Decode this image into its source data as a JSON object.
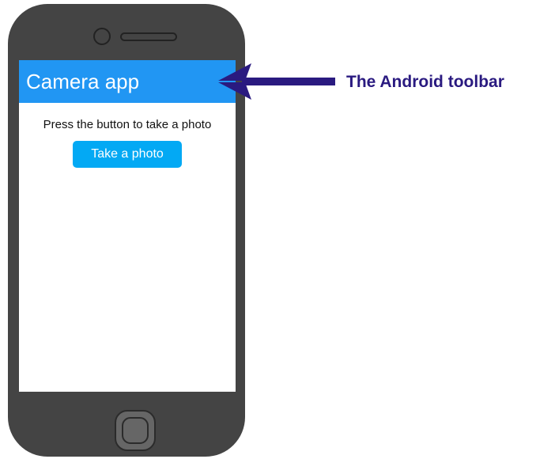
{
  "phone": {
    "toolbar": {
      "title": "Camera app"
    },
    "content": {
      "prompt": "Press the button to take a photo",
      "button_label": "Take a photo"
    }
  },
  "annotation": {
    "label": "The Android toolbar"
  },
  "colors": {
    "toolbar": "#2196f3",
    "button": "#03a9f4",
    "phone_body": "#444444",
    "annotation": "#2a1a80"
  }
}
